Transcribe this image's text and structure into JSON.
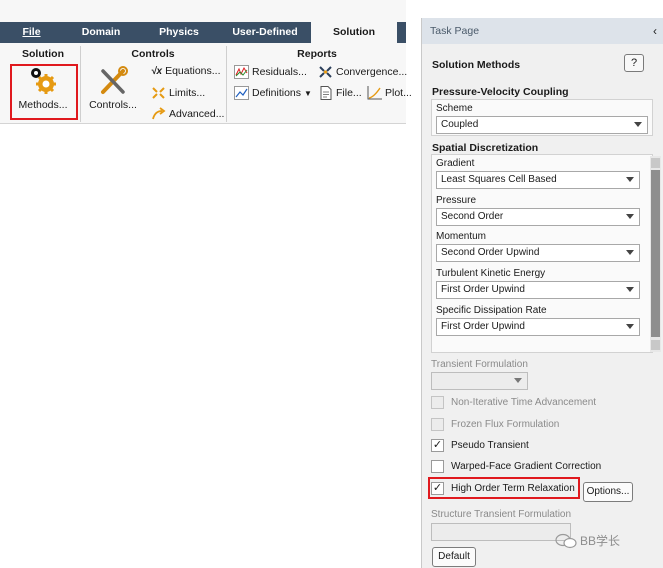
{
  "ribbon": {
    "tabs": [
      "File",
      "Domain",
      "Physics",
      "User-Defined",
      "Solution"
    ],
    "active_tab": "Solution",
    "groups": {
      "solution": {
        "title": "Solution",
        "methods_label": "Methods..."
      },
      "controls": {
        "title": "Controls",
        "controls_label": "Controls...",
        "equations_label": "Equations...",
        "limits_label": "Limits...",
        "advanced_label": "Advanced..."
      },
      "reports": {
        "title": "Reports",
        "residuals_label": "Residuals...",
        "convergence_label": "Convergence...",
        "definitions_label": "Definitions",
        "file_label": "File...",
        "plot_label": "Plot..."
      }
    }
  },
  "task_page": {
    "header": "Task Page",
    "title": "Solution Methods",
    "help_label": "?",
    "pv_coupling": {
      "title": "Pressure-Velocity Coupling",
      "scheme_label": "Scheme",
      "scheme_value": "Coupled"
    },
    "spatial": {
      "title": "Spatial Discretization",
      "items": [
        {
          "label": "Gradient",
          "value": "Least Squares Cell Based"
        },
        {
          "label": "Pressure",
          "value": "Second Order"
        },
        {
          "label": "Momentum",
          "value": "Second Order Upwind"
        },
        {
          "label": "Turbulent Kinetic Energy",
          "value": "First Order Upwind"
        },
        {
          "label": "Specific Dissipation Rate",
          "value": "First Order Upwind"
        }
      ]
    },
    "transient_formulation_label": "Transient Formulation",
    "checkboxes": [
      {
        "label": "Non-Iterative Time Advancement",
        "checked": false,
        "enabled": false
      },
      {
        "label": "Frozen Flux Formulation",
        "checked": false,
        "enabled": false
      },
      {
        "label": "Pseudo Transient",
        "checked": true,
        "enabled": true
      },
      {
        "label": "Warped-Face Gradient Correction",
        "checked": false,
        "enabled": true
      },
      {
        "label": "High Order Term Relaxation",
        "checked": true,
        "enabled": true
      }
    ],
    "options_label": "Options...",
    "structure_transient_label": "Structure Transient Formulation",
    "default_label": "Default"
  },
  "watermark": "BB学长",
  "colors": {
    "tab_bar": "#3a4f66",
    "highlight_red": "#e0191e",
    "task_header": "#dde3ea"
  }
}
